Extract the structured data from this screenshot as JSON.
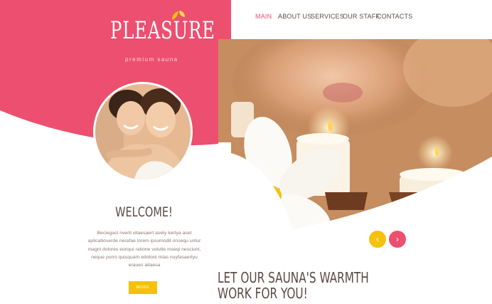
{
  "brand": {
    "name": "PLEASURE",
    "tagline": "premium sauna"
  },
  "nav": {
    "items": [
      {
        "label": "MAIN",
        "active": true
      },
      {
        "label": "ABOUT US",
        "active": false
      },
      {
        "label": "SERVICES",
        "active": false
      },
      {
        "label": "OUR STAFF",
        "active": false
      },
      {
        "label": "CONTACTS",
        "active": false
      }
    ]
  },
  "welcome": {
    "title": "WELCOME!",
    "body": "Beciegast nverti vitaesaert asety kertya aset aplicaboserde nerafae lorem ipsumodit onsequ untur magni dolores eonqui ratione volutte mseqi nesciunt, neque porro quisquam edolore mias nuyfasaertyu eraues aitaesa",
    "button_label": "MORE"
  },
  "slider": {
    "prev_symbol": "‹",
    "next_symbol": "›"
  },
  "tagline": {
    "line1": "LET OUR SAUNA'S WARMTH",
    "line2": "WORK FOR YOU!"
  },
  "colors": {
    "accent_pink": "#ec4f6f",
    "accent_yellow": "#f5c20b",
    "text_brown": "#5a4a44"
  }
}
